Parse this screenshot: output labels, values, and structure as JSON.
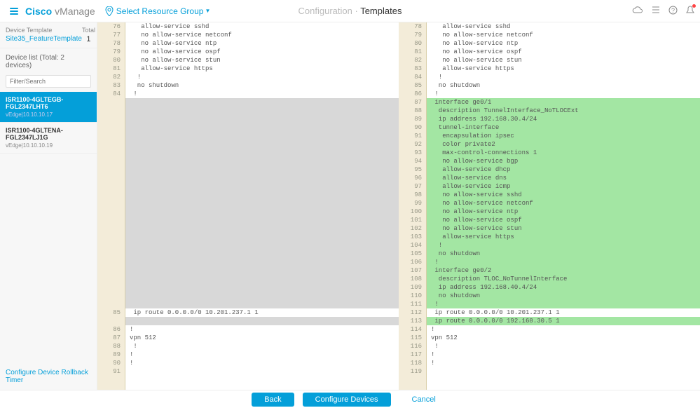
{
  "header": {
    "logo": "Cisco",
    "product": "vManage",
    "resource_label": "Select Resource Group",
    "breadcrumb_prefix": "Configuration · ",
    "breadcrumb_current": "Templates"
  },
  "sidebar": {
    "device_template_label": "Device Template",
    "device_template_value": "Site35_FeatureTemplate",
    "total_label": "Total",
    "total_value": "1",
    "device_list_label": "Device list (Total: 2 devices)",
    "search_placeholder": "Filter/Search",
    "items": [
      {
        "name": "ISR1100-4GLTEGB-FGL2347LHT6",
        "sub": "vEdge|10.10.10.17",
        "active": true
      },
      {
        "name": "ISR1100-4GLTENA-FGL2347LJ1G",
        "sub": "vEdge|10.10.10.19",
        "active": false
      }
    ],
    "rollback_link": "Configure Device Rollback Timer"
  },
  "diff": {
    "left": [
      {
        "n": 76,
        "t": "   allow-service sshd",
        "c": "same"
      },
      {
        "n": 77,
        "t": "   no allow-service netconf",
        "c": "same"
      },
      {
        "n": 78,
        "t": "   no allow-service ntp",
        "c": "same"
      },
      {
        "n": 79,
        "t": "   no allow-service ospf",
        "c": "same"
      },
      {
        "n": 80,
        "t": "   no allow-service stun",
        "c": "same"
      },
      {
        "n": 81,
        "t": "   allow-service https",
        "c": "same"
      },
      {
        "n": 82,
        "t": "  !",
        "c": "same"
      },
      {
        "n": 83,
        "t": "  no shutdown",
        "c": "same"
      },
      {
        "n": 84,
        "t": " !",
        "c": "same"
      },
      {
        "n": "",
        "t": "",
        "c": "pad"
      },
      {
        "n": "",
        "t": "",
        "c": "pad"
      },
      {
        "n": "",
        "t": "",
        "c": "pad"
      },
      {
        "n": "",
        "t": "",
        "c": "pad"
      },
      {
        "n": "",
        "t": "",
        "c": "pad"
      },
      {
        "n": "",
        "t": "",
        "c": "pad"
      },
      {
        "n": "",
        "t": "",
        "c": "pad"
      },
      {
        "n": "",
        "t": "",
        "c": "pad"
      },
      {
        "n": "",
        "t": "",
        "c": "pad"
      },
      {
        "n": "",
        "t": "",
        "c": "pad"
      },
      {
        "n": "",
        "t": "",
        "c": "pad"
      },
      {
        "n": "",
        "t": "",
        "c": "pad"
      },
      {
        "n": "",
        "t": "",
        "c": "pad"
      },
      {
        "n": "",
        "t": "",
        "c": "pad"
      },
      {
        "n": "",
        "t": "",
        "c": "pad"
      },
      {
        "n": "",
        "t": "",
        "c": "pad"
      },
      {
        "n": "",
        "t": "",
        "c": "pad"
      },
      {
        "n": "",
        "t": "",
        "c": "pad"
      },
      {
        "n": "",
        "t": "",
        "c": "pad"
      },
      {
        "n": "",
        "t": "",
        "c": "pad"
      },
      {
        "n": "",
        "t": "",
        "c": "pad"
      },
      {
        "n": "",
        "t": "",
        "c": "pad"
      },
      {
        "n": "",
        "t": "",
        "c": "pad"
      },
      {
        "n": "",
        "t": "",
        "c": "pad"
      },
      {
        "n": "",
        "t": "",
        "c": "pad"
      },
      {
        "n": 85,
        "t": " ip route 0.0.0.0/0 10.201.237.1 1",
        "c": "same"
      },
      {
        "n": "",
        "t": "",
        "c": "pad"
      },
      {
        "n": 86,
        "t": "!",
        "c": "same"
      },
      {
        "n": 87,
        "t": "vpn 512",
        "c": "same"
      },
      {
        "n": 88,
        "t": " !",
        "c": "same"
      },
      {
        "n": 89,
        "t": "!",
        "c": "same"
      },
      {
        "n": 90,
        "t": "!",
        "c": "same"
      },
      {
        "n": 91,
        "t": "",
        "c": "same"
      }
    ],
    "right": [
      {
        "n": 78,
        "t": "   allow-service sshd",
        "c": "same"
      },
      {
        "n": 79,
        "t": "   no allow-service netconf",
        "c": "same"
      },
      {
        "n": 80,
        "t": "   no allow-service ntp",
        "c": "same"
      },
      {
        "n": 81,
        "t": "   no allow-service ospf",
        "c": "same"
      },
      {
        "n": 82,
        "t": "   no allow-service stun",
        "c": "same"
      },
      {
        "n": 83,
        "t": "   allow-service https",
        "c": "same"
      },
      {
        "n": 84,
        "t": "  !",
        "c": "same"
      },
      {
        "n": 85,
        "t": "  no shutdown",
        "c": "same"
      },
      {
        "n": 86,
        "t": " !",
        "c": "same"
      },
      {
        "n": 87,
        "t": " interface ge0/1",
        "c": "add"
      },
      {
        "n": 88,
        "t": "  description TunnelInterface_NoTLOCExt",
        "c": "add"
      },
      {
        "n": 89,
        "t": "  ip address 192.168.30.4/24",
        "c": "add"
      },
      {
        "n": 90,
        "t": "  tunnel-interface",
        "c": "add"
      },
      {
        "n": 91,
        "t": "   encapsulation ipsec",
        "c": "add"
      },
      {
        "n": 92,
        "t": "   color private2",
        "c": "add"
      },
      {
        "n": 93,
        "t": "   max-control-connections 1",
        "c": "add"
      },
      {
        "n": 94,
        "t": "   no allow-service bgp",
        "c": "add"
      },
      {
        "n": 95,
        "t": "   allow-service dhcp",
        "c": "add"
      },
      {
        "n": 96,
        "t": "   allow-service dns",
        "c": "add"
      },
      {
        "n": 97,
        "t": "   allow-service icmp",
        "c": "add"
      },
      {
        "n": 98,
        "t": "   no allow-service sshd",
        "c": "add"
      },
      {
        "n": 99,
        "t": "   no allow-service netconf",
        "c": "add"
      },
      {
        "n": 100,
        "t": "   no allow-service ntp",
        "c": "add"
      },
      {
        "n": 101,
        "t": "   no allow-service ospf",
        "c": "add"
      },
      {
        "n": 102,
        "t": "   no allow-service stun",
        "c": "add"
      },
      {
        "n": 103,
        "t": "   allow-service https",
        "c": "add"
      },
      {
        "n": 104,
        "t": "  !",
        "c": "add"
      },
      {
        "n": 105,
        "t": "  no shutdown",
        "c": "add"
      },
      {
        "n": 106,
        "t": " !",
        "c": "add"
      },
      {
        "n": 107,
        "t": " interface ge0/2",
        "c": "add"
      },
      {
        "n": 108,
        "t": "  description TLOC_NoTunnelInterface",
        "c": "add"
      },
      {
        "n": 109,
        "t": "  ip address 192.168.40.4/24",
        "c": "add"
      },
      {
        "n": 110,
        "t": "  no shutdown",
        "c": "add"
      },
      {
        "n": 111,
        "t": " !",
        "c": "add"
      },
      {
        "n": 112,
        "t": " ip route 0.0.0.0/0 10.201.237.1 1",
        "c": "same"
      },
      {
        "n": 113,
        "t": " ip route 0.0.0.0/0 192.168.30.5 1",
        "c": "add"
      },
      {
        "n": 114,
        "t": "!",
        "c": "same"
      },
      {
        "n": 115,
        "t": "vpn 512",
        "c": "same"
      },
      {
        "n": 116,
        "t": " !",
        "c": "same"
      },
      {
        "n": 117,
        "t": "!",
        "c": "same"
      },
      {
        "n": 118,
        "t": "!",
        "c": "same"
      },
      {
        "n": 119,
        "t": "",
        "c": "same"
      }
    ]
  },
  "footer": {
    "back": "Back",
    "configure": "Configure Devices",
    "cancel": "Cancel"
  }
}
